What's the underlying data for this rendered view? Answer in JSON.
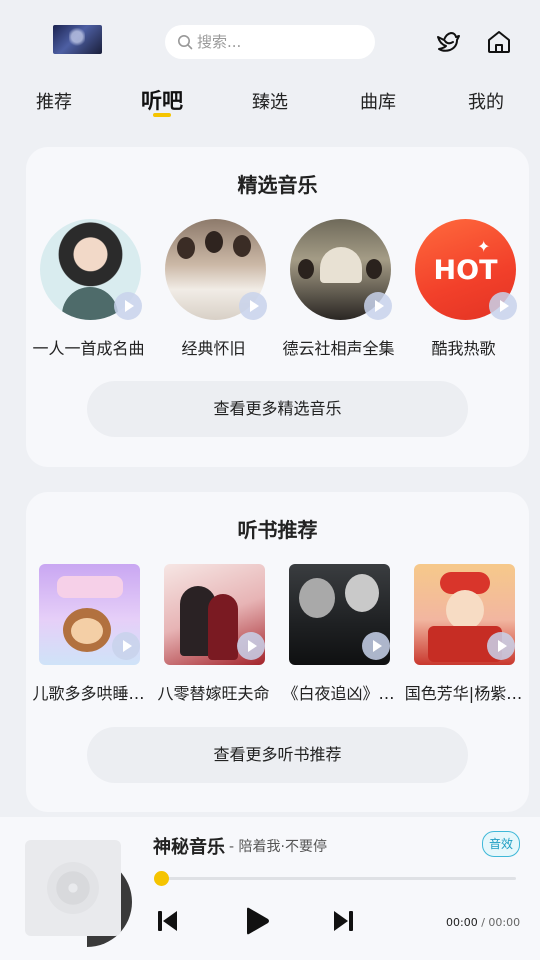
{
  "search": {
    "placeholder": "搜索..."
  },
  "tabs": [
    {
      "label": "推荐",
      "active": false
    },
    {
      "label": "听吧",
      "active": true
    },
    {
      "label": "臻选",
      "active": false
    },
    {
      "label": "曲库",
      "active": false
    },
    {
      "label": "我的",
      "active": false
    }
  ],
  "music_section": {
    "title": "精选音乐",
    "items": [
      {
        "label": "一人一首成名曲"
      },
      {
        "label": "经典怀旧"
      },
      {
        "label": "德云社相声全集"
      },
      {
        "label": "酷我热歌"
      }
    ],
    "hot_text": "HOT",
    "more_label": "查看更多精选音乐"
  },
  "book_section": {
    "title": "听书推荐",
    "items": [
      {
        "label": "儿歌多多哄睡…"
      },
      {
        "label": "八零替嫁旺夫命"
      },
      {
        "label": "《白夜追凶》…"
      },
      {
        "label": "国色芳华|杨紫…"
      }
    ],
    "more_label": "查看更多听书推荐"
  },
  "player": {
    "title": "神秘音乐",
    "artist": "- 陪着我·不要停",
    "fx_label": "音效",
    "current_time": "00:00",
    "separator": "/",
    "total_time": "00:00",
    "progress": 0
  },
  "colors": {
    "accent": "#f5c400",
    "badge": "#1d9dc2",
    "background": "#eef0f4"
  },
  "icons": [
    "search-icon",
    "bird-icon",
    "home-icon",
    "play-icon",
    "previous-icon",
    "next-icon"
  ]
}
